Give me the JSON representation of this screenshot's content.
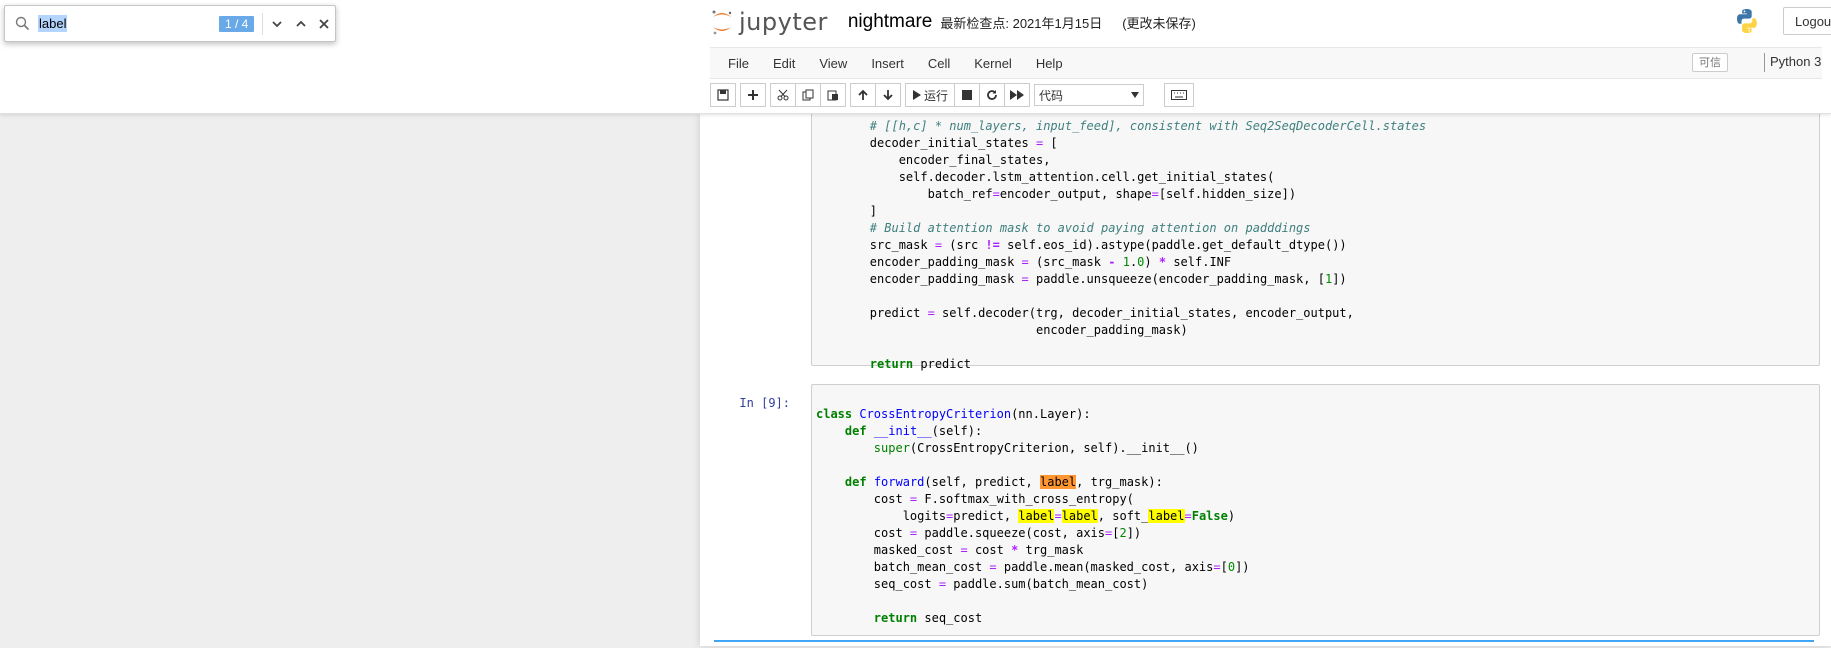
{
  "find": {
    "query": "label",
    "count": "1 / 4"
  },
  "header": {
    "logo_text": "jupyter",
    "notebook_name": "nightmare",
    "checkpoint": "最新检查点: 2021年1月15日",
    "autosave": "(更改未保存)",
    "logout": "Logout"
  },
  "menu": {
    "items": [
      "File",
      "Edit",
      "View",
      "Insert",
      "Cell",
      "Kernel",
      "Help"
    ],
    "trusted": "可信",
    "kernel": "Python 3"
  },
  "toolbar": {
    "run_label": "运行",
    "cell_type": "代码"
  },
  "cells": [
    {
      "prompt": "",
      "lines": [
        "        # [[h,c] * num_layers, input_feed], consistent with Seq2SeqDecoderCell.states",
        "        decoder_initial_states = [",
        "            encoder_final_states,",
        "            self.decoder.lstm_attention.cell.get_initial_states(",
        "                batch_ref=encoder_output, shape=[self.hidden_size])",
        "        ]",
        "        # Build attention mask to avoid paying attention on padddings",
        "        src_mask = (src != self.eos_id).astype(paddle.get_default_dtype())",
        "        encoder_padding_mask = (src_mask - 1.0) * self.INF",
        "        encoder_padding_mask = paddle.unsqueeze(encoder_padding_mask, [1])",
        "",
        "        predict = self.decoder(trg, decoder_initial_states, encoder_output,",
        "                               encoder_padding_mask)",
        "",
        "        return predict"
      ]
    },
    {
      "prompt": "In  [9]:",
      "lines": [
        "class CrossEntropyCriterion(nn.Layer):",
        "    def __init__(self):",
        "        super(CrossEntropyCriterion, self).__init__()",
        "",
        "    def forward(self, predict, label, trg_mask):",
        "        cost = F.softmax_with_cross_entropy(",
        "            logits=predict, label=label, soft_label=False)",
        "        cost = paddle.squeeze(cost, axis=[2])",
        "        masked_cost = cost * trg_mask",
        "        batch_mean_cost = paddle.mean(masked_cost, axis=[0])",
        "        seq_cost = paddle.sum(batch_mean_cost)",
        "",
        "        return seq_cost"
      ]
    }
  ],
  "colors": {
    "prompt": "#303f9f",
    "keyword": "#008000",
    "comment": "#408080",
    "match_current": "#ff9632",
    "match_other": "#ffff00",
    "find_count_bg": "#6aa9e8"
  },
  "icons": {
    "find": "search-icon",
    "next": "chevron-down-icon",
    "prev": "chevron-up-icon",
    "close": "close-icon",
    "logo": "jupyter-logo-icon",
    "python": "python-logo-icon"
  }
}
